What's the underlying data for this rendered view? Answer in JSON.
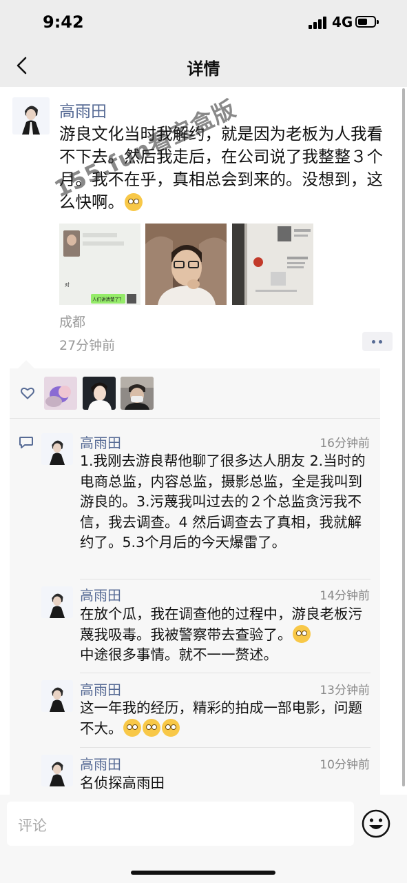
{
  "status_bar": {
    "time": "9:42",
    "network": "4G"
  },
  "nav": {
    "title": "详情"
  },
  "post": {
    "author": "高雨田",
    "text": "游良文化当时我解约，就是因为老板为人我看不下去。然后我走后，在公司说了我整整３个月。我不在乎，真相总会到来的。没想到，这么快啊。",
    "photos": [
      {
        "caption": "人们讲清楚了？",
        "small_text": "对"
      },
      {},
      {}
    ],
    "location": "成都",
    "time_ago": "27分钟前"
  },
  "watermark": "155.fun看宝盒版",
  "comments": [
    {
      "name": "高雨田",
      "time": "16分钟前",
      "text": "1.我刚去游良帮他聊了很多达人朋友 2.当时的电商总监，内容总监，摄影总监，全是我叫到游良的。3.污蔑我叫过去的２个总监贪污我不信，我去调查。4 然后调查去了真相，我就解约了。5.3个月后的今天爆雷了。"
    },
    {
      "name": "高雨田",
      "time": "14分钟前",
      "text": "在放个瓜，我在调查他的过程中，游良老板污蔑我吸毒。我被警察带去查验了。",
      "text2": "中途很多事情。就不一一赘述。"
    },
    {
      "name": "高雨田",
      "time": "13分钟前",
      "text": "这一年我的经历，精彩的拍成一部电影，问题不大。"
    },
    {
      "name": "高雨田",
      "time": "10分钟前",
      "text": "名侦探高雨田"
    }
  ],
  "comment_input": {
    "placeholder": "评论"
  },
  "colors": {
    "name_blue": "#576b95",
    "bg_gray": "#ededed",
    "box_gray": "#f7f7f7"
  },
  "icons": [
    "back-icon",
    "heart-icon",
    "comment-icon",
    "more-icon",
    "emoji-icon",
    "signal-icon",
    "battery-icon"
  ]
}
